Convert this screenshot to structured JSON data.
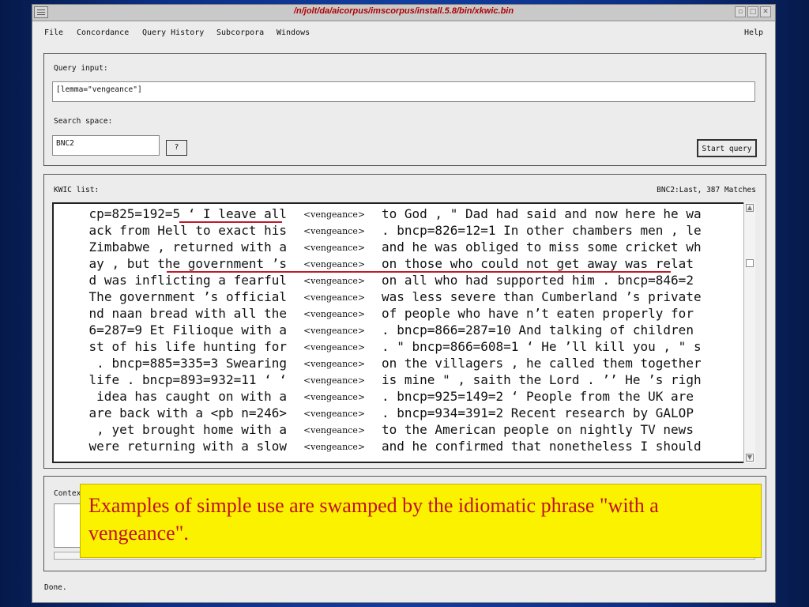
{
  "window": {
    "title": "/n/jolt/da/aicorpus/imscorpus/install.5.8/bin/xkwic.bin"
  },
  "menu": {
    "items": [
      "File",
      "Concordance",
      "Query History",
      "Subcorpora",
      "Windows"
    ],
    "help": "Help"
  },
  "query_panel": {
    "query_label": "Query input:",
    "query_value": "[lemma=\"vengeance\"]",
    "search_label": "Search space:",
    "search_value": "BNC2",
    "help_button": "?",
    "start_button": "Start query"
  },
  "kwic_panel": {
    "label": "KWIC list:",
    "status": "BNC2:Last, 387 Matches",
    "rows": [
      {
        "left": "cp=825=192=5 ‘ I leave all",
        "key": "<vengeance>",
        "right": "to God , \" Dad had said and now here he wa"
      },
      {
        "left": "ack from Hell to exact his",
        "key": "<vengeance>",
        "right": ". bncp=826=12=1 In other chambers men , le"
      },
      {
        "left": "Zimbabwe , returned with a",
        "key": "<vengeance>",
        "right": "and he was obliged to miss some cricket wh"
      },
      {
        "left": "ay , but the government ’s",
        "key": "<vengeance>",
        "right": "on those who could not get away was relat"
      },
      {
        "left": "d was inflicting a fearful",
        "key": "<vengeance>",
        "right": "on all who had supported him . bncp=846=2"
      },
      {
        "left": "The government ’s official",
        "key": "<vengeance>",
        "right": "was less severe than Cumberland ’s private"
      },
      {
        "left": "nd naan bread with all the",
        "key": "<vengeance>",
        "right": "of people who have n’t eaten properly for"
      },
      {
        "left": "6=287=9 Et Filioque with a",
        "key": "<vengeance>",
        "right": ". bncp=866=287=10 And talking of children"
      },
      {
        "left": "st of his life hunting for",
        "key": "<vengeance>",
        "right": ". \" bncp=866=608=1 ‘ He ’ll kill you , \" s"
      },
      {
        "left": ". bncp=885=335=3 Swearing",
        "key": "<vengeance>",
        "right": "on the villagers , he called them together"
      },
      {
        "left": "life . bncp=893=932=11 ‘ ‘",
        "key": "<vengeance>",
        "right": "is mine \" , saith the Lord . ’’ He ’s righ"
      },
      {
        "left": "idea has caught on with a",
        "key": "<vengeance>",
        "right": ". bncp=925=149=2 ‘ People from the UK are"
      },
      {
        "left": "are back with a <pb n=246>",
        "key": "<vengeance>",
        "right": ". bncp=934=391=2 Recent research by GALOP"
      },
      {
        "left": ", yet brought home with a",
        "key": "<vengeance>",
        "right": "to the American people on nightly TV news"
      },
      {
        "left": "were returning with a slow",
        "key": "<vengeance>",
        "right": "and he confirmed that nonetheless I should"
      }
    ]
  },
  "context_panel": {
    "label": "Context"
  },
  "status_bar": {
    "text": "Done."
  },
  "callout": {
    "text": "Examples of simple use are swamped by the idiomatic phrase \"with a vengeance\"."
  },
  "colors": {
    "title_text": "#b00000",
    "underline": "#c01a2c",
    "callout_bg": "#fbf200",
    "callout_text": "#c0111f"
  }
}
